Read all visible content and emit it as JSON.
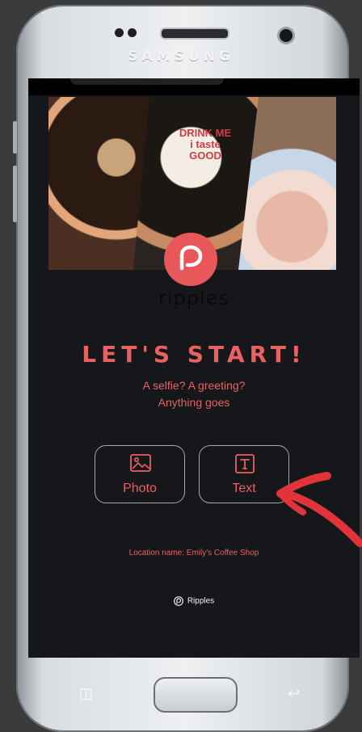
{
  "device": {
    "brand": "SAMSUNG"
  },
  "collage": {
    "sign_text": "DRINK ME\ni taste\nGOOD"
  },
  "app": {
    "wordmark": "ripples"
  },
  "main": {
    "headline": "LET'S START!",
    "subtitle_line1": "A selfie? A greeting?",
    "subtitle_line2": "Anything goes",
    "options": [
      {
        "label": "Photo",
        "icon": "image-icon"
      },
      {
        "label": "Text",
        "icon": "text-icon"
      }
    ],
    "location": "Location name: Emily's Coffee Shop"
  },
  "footer": {
    "brand": "Ripples"
  },
  "colors": {
    "accent": "#e86262",
    "background": "#16171b",
    "logo": "#e8585a"
  }
}
